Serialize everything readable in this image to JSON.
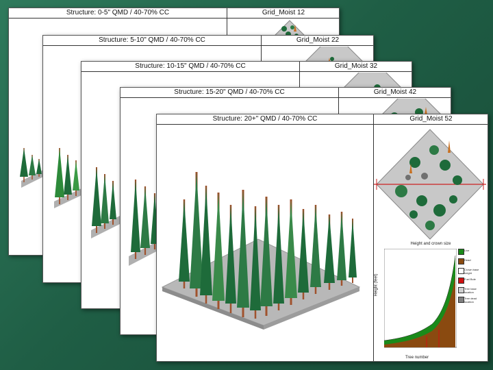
{
  "slides": [
    {
      "structure": "Structure: 0-5\" QMD / 40-70% CC",
      "plot": "Grid_Moist 12"
    },
    {
      "structure": "Structure: 5-10\" QMD / 40-70% CC",
      "plot": "Grid_Moist 22"
    },
    {
      "structure": "Structure: 10-15\" QMD / 40-70% CC",
      "plot": "Grid_Moist 32"
    },
    {
      "structure": "Structure: 15-20\" QMD / 40-70% CC",
      "plot": "Grid_Moist 42"
    },
    {
      "structure": "Structure: 20+\" QMD / 40-70% CC",
      "plot": "Grid_Moist 52"
    }
  ],
  "height_chart": {
    "title": "Height and crown size",
    "xlabel": "Tree number",
    "ylabel": "Height (feet)",
    "legend": [
      {
        "label": "Live",
        "color": "#1a8a1a"
      },
      {
        "label": "Dead",
        "color": "#8a4a10"
      },
      {
        "label": "Crown base height",
        "color": "#ffffff"
      },
      {
        "label": "Fuel Bole",
        "color": "#d01010"
      },
      {
        "label": "Tree base location",
        "color": "#cfcfcf"
      },
      {
        "label": "Tree dead location",
        "color": "#808080"
      }
    ],
    "y_ticks": [
      "0",
      "10",
      "20",
      "30",
      "40",
      "50",
      "60",
      "70",
      "80",
      "90",
      "100",
      "110",
      "120",
      "130",
      "140",
      "150",
      "160"
    ]
  },
  "colors": {
    "background": "#1f5e45",
    "foliage": "#1e6b3a",
    "stem": "#a0522d",
    "ground": "#b8b8b8"
  }
}
